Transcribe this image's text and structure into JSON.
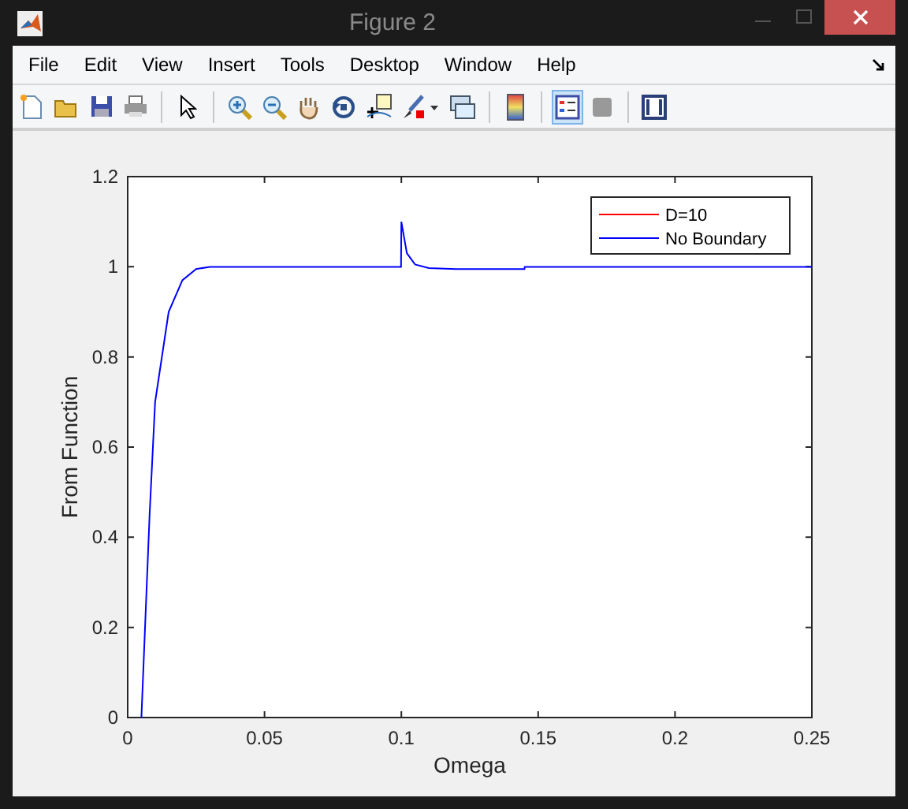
{
  "window": {
    "title": "Figure 2"
  },
  "menu": [
    "File",
    "Edit",
    "View",
    "Insert",
    "Tools",
    "Desktop",
    "Window",
    "Help"
  ],
  "toolbar": [
    {
      "pressed": false
    },
    {
      "pressed": false
    },
    {
      "pressed": false
    },
    {
      "pressed": false
    },
    {
      "pressed": false
    },
    {
      "pressed": false
    },
    {
      "pressed": false
    },
    {
      "pressed": false
    },
    {
      "pressed": false
    },
    {
      "pressed": false
    },
    {
      "pressed": false
    },
    {
      "pressed": false
    },
    {
      "pressed": false
    },
    {
      "pressed": true
    },
    {
      "pressed": false
    },
    {
      "pressed": false
    }
  ],
  "plot": {
    "chart_data": {
      "type": "line",
      "xlabel": "Omega",
      "ylabel": "From Function",
      "x": [
        0.005,
        0.008,
        0.01,
        0.015,
        0.02,
        0.025,
        0.03,
        0.0999,
        0.1,
        0.102,
        0.105,
        0.11,
        0.12,
        0.145,
        0.1451,
        0.25
      ],
      "series": [
        {
          "name": "D=10",
          "color": "#ff0000",
          "values": [
            null,
            null,
            null,
            null,
            null,
            null,
            null,
            null,
            null,
            null,
            null,
            null,
            null,
            null,
            null,
            null
          ]
        },
        {
          "name": "No Boundary",
          "color": "#0000ff",
          "values": [
            0,
            0.45,
            0.7,
            0.9,
            0.97,
            0.995,
            1,
            1,
            1.1,
            1.03,
            1.005,
            0.997,
            0.995,
            0.995,
            1,
            1
          ]
        }
      ],
      "xlim": [
        0,
        0.25
      ],
      "ylim": [
        0,
        1.2
      ],
      "xticks": [
        {
          "value": 0,
          "label": "0"
        },
        {
          "value": 0.05,
          "label": "0.05"
        },
        {
          "value": 0.1,
          "label": "0.1"
        },
        {
          "value": 0.15,
          "label": "0.15"
        },
        {
          "value": 0.2,
          "label": "0.2"
        },
        {
          "value": 0.25,
          "label": "0.25"
        }
      ],
      "yticks": [
        {
          "value": 0,
          "label": "0"
        },
        {
          "value": 0.2,
          "label": "0.2"
        },
        {
          "value": 0.4,
          "label": "0.4"
        },
        {
          "value": 0.6,
          "label": "0.6"
        },
        {
          "value": 0.8,
          "label": "0.8"
        },
        {
          "value": 1,
          "label": "1"
        },
        {
          "value": 1.2,
          "label": "1.2"
        }
      ]
    }
  }
}
